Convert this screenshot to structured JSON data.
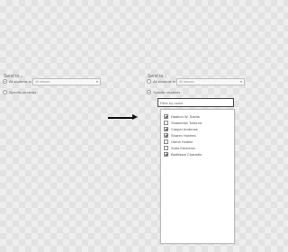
{
  "before": {
    "send_to_label": "Send to...",
    "all_students_label": "All students in",
    "all_students_selected": true,
    "class_select_value": "All classes",
    "specific_students_label": "Specific students",
    "specific_students_selected": false
  },
  "after": {
    "send_to_label": "Send to...",
    "all_students_label": "All students in",
    "all_students_selected": false,
    "class_select_value": "All classes",
    "specific_students_label": "Specific students",
    "specific_students_selected": true,
    "filter_placeholder": "Filter by name",
    "students": [
      {
        "name": "Haakon W. Sachs",
        "checked": true
      },
      {
        "name": "Shakeelah Tohkura",
        "checked": false
      },
      {
        "name": "Casper Ambrose",
        "checked": true
      },
      {
        "name": "Sharen Holmes",
        "checked": true
      },
      {
        "name": "Olena Hodkin",
        "checked": false
      },
      {
        "name": "Sofia Klemerov",
        "checked": false
      },
      {
        "name": "Balthasar Charadis",
        "checked": true
      }
    ]
  },
  "icons": {
    "transition": "right-arrow-icon",
    "dropdown": "chevron-down-icon"
  },
  "colors": {
    "radio_selected": "#3a6ab2",
    "filter_border": "#4a4a4a",
    "arrow": "#111111"
  }
}
